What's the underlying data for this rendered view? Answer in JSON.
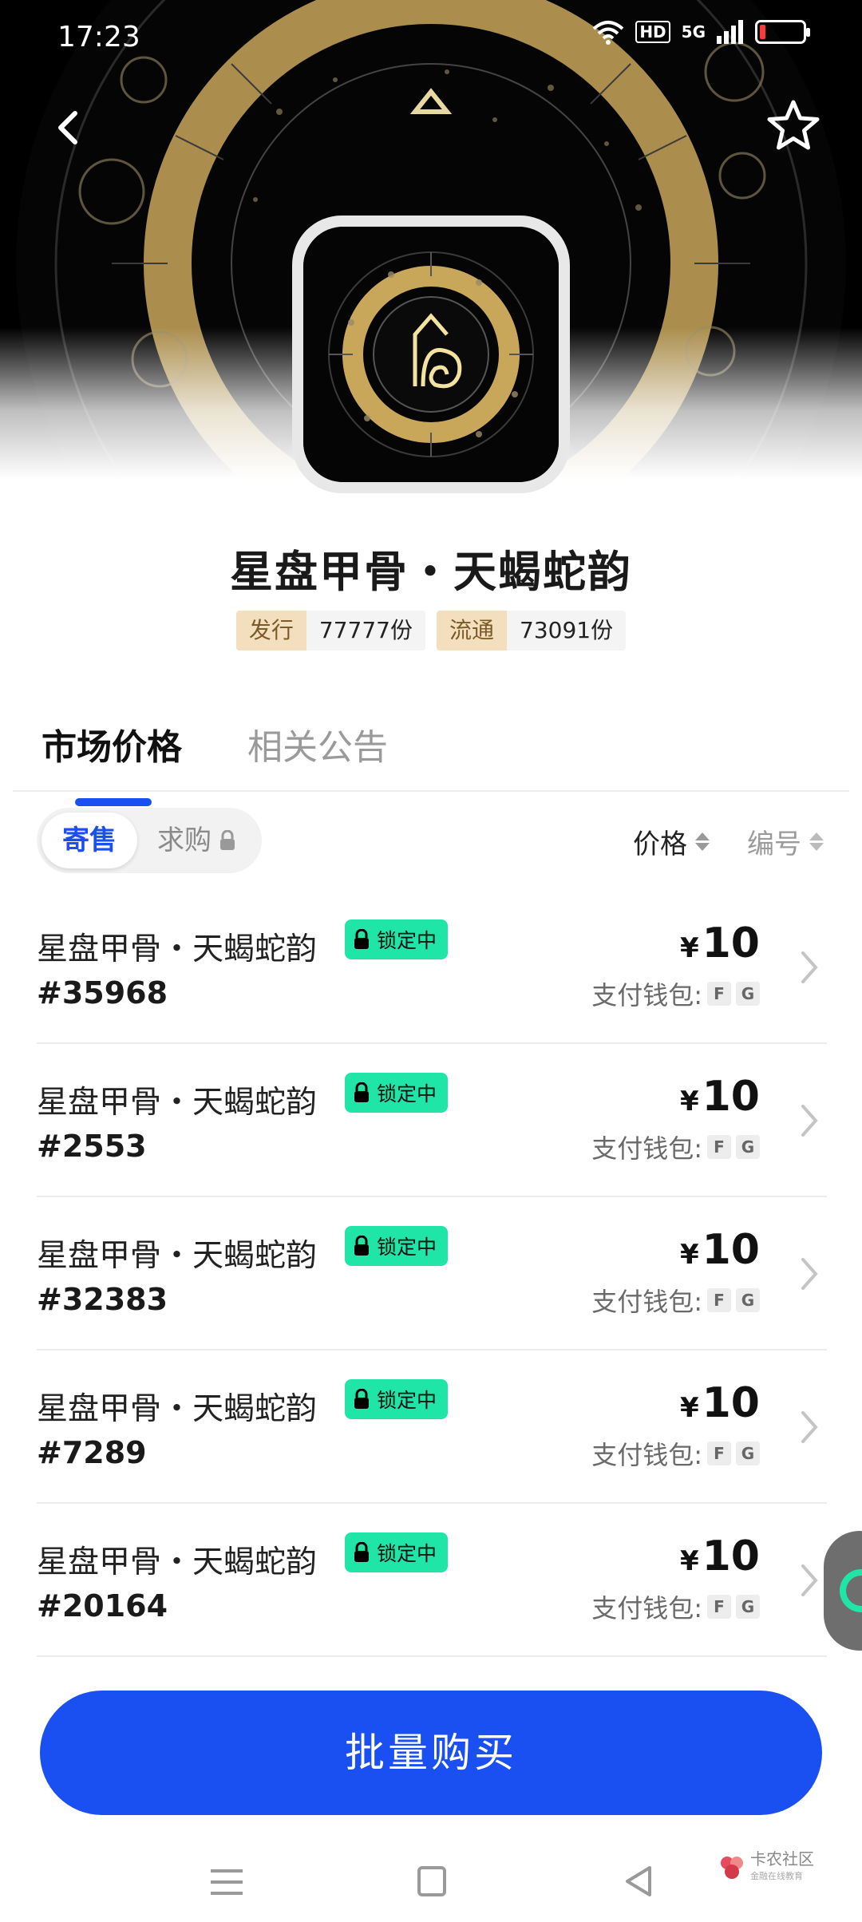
{
  "status_bar": {
    "time": "17:23",
    "hd_label": "HD",
    "network_label": "5G"
  },
  "item": {
    "title": "星盘甲骨・天蝎蛇韵",
    "issued_label": "发行",
    "issued_value": "77777份",
    "circulation_label": "流通",
    "circulation_value": "73091份"
  },
  "tabs": [
    "市场价格",
    "相关公告"
  ],
  "filter": {
    "sell_label": "寄售",
    "buy_label": "求购",
    "sort_price_label": "价格",
    "sort_number_label": "编号"
  },
  "listings": [
    {
      "name": "星盘甲骨・天蝎蛇韵",
      "badge": "锁定中",
      "serial": "#35968",
      "currency": "¥",
      "price": "10",
      "wallet_label": "支付钱包:",
      "chips": [
        "F",
        "G"
      ]
    },
    {
      "name": "星盘甲骨・天蝎蛇韵",
      "badge": "锁定中",
      "serial": "#2553",
      "currency": "¥",
      "price": "10",
      "wallet_label": "支付钱包:",
      "chips": [
        "F",
        "G"
      ]
    },
    {
      "name": "星盘甲骨・天蝎蛇韵",
      "badge": "锁定中",
      "serial": "#32383",
      "currency": "¥",
      "price": "10",
      "wallet_label": "支付钱包:",
      "chips": [
        "F",
        "G"
      ]
    },
    {
      "name": "星盘甲骨・天蝎蛇韵",
      "badge": "锁定中",
      "serial": "#7289",
      "currency": "¥",
      "price": "10",
      "wallet_label": "支付钱包:",
      "chips": [
        "F",
        "G"
      ]
    },
    {
      "name": "星盘甲骨・天蝎蛇韵",
      "badge": "锁定中",
      "serial": "#20164",
      "currency": "¥",
      "price": "10",
      "wallet_label": "支付钱包:",
      "chips": [
        "F",
        "G"
      ]
    }
  ],
  "buy_button": "批量购买",
  "watermark": {
    "name": "卡农社区",
    "sub": "金融在线教育"
  },
  "colors": {
    "accent": "#1a4ff2",
    "badge": "#1fe6a6",
    "stat_key_bg": "#f3dfbd",
    "gold": "#c9a75a"
  },
  "icons": [
    "back-icon",
    "star-icon",
    "lock-icon",
    "chevron-right-icon",
    "menu-icon",
    "home-icon",
    "back-triangle-icon"
  ]
}
